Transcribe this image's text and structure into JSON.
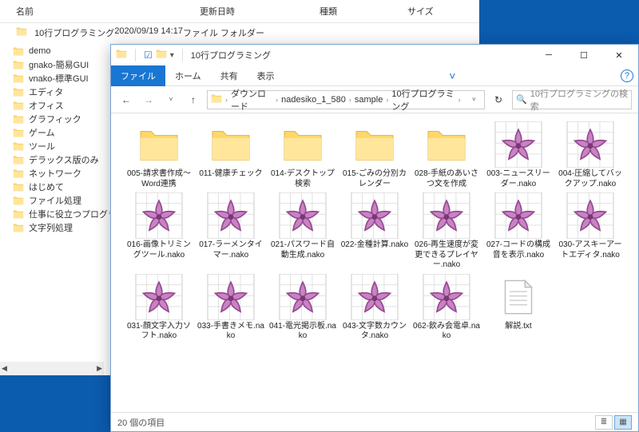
{
  "back": {
    "headers": {
      "name": "名前",
      "date": "更新日時",
      "type": "種類",
      "size": "サイズ"
    },
    "row": {
      "date": "2020/09/19 14:17",
      "type": "ファイル フォルダー"
    },
    "items": [
      "10行プログラミング",
      "demo",
      "gnako-簡易GUI",
      "vnako-標準GUI",
      "エディタ",
      "オフィス",
      "グラフィック",
      "ゲーム",
      "ツール",
      "デラックス版のみ",
      "ネットワーク",
      "はじめて",
      "ファイル処理",
      "仕事に役立つプログラミ",
      "文字列処理"
    ]
  },
  "front": {
    "title": "10行プログラミング",
    "tabs": {
      "file": "ファイル",
      "home": "ホーム",
      "share": "共有",
      "view": "表示"
    },
    "breadcrumb": [
      "ダウンロード",
      "nadesiko_1_580",
      "sample",
      "10行プログラミング"
    ],
    "search_placeholder": "10行プログラミングの検索",
    "grid": [
      {
        "name": "005-請求書作成～Word連携",
        "kind": "folder"
      },
      {
        "name": "011-健康チェック",
        "kind": "folder"
      },
      {
        "name": "014-デスクトップ検索",
        "kind": "folder"
      },
      {
        "name": "015-ごみの分別カレンダー",
        "kind": "folder"
      },
      {
        "name": "028-手紙のあいさつ文を作成",
        "kind": "folder"
      },
      {
        "name": "003-ニュースリーダー.nako",
        "kind": "nako"
      },
      {
        "name": "004-圧縮してバックアップ.nako",
        "kind": "nako"
      },
      {
        "name": "016-画像トリミングツール.nako",
        "kind": "nako"
      },
      {
        "name": "017-ラーメンタイマー.nako",
        "kind": "nako"
      },
      {
        "name": "021-パスワード自動生成.nako",
        "kind": "nako"
      },
      {
        "name": "022-金種計算.nako",
        "kind": "nako"
      },
      {
        "name": "026-再生速度が変更できるプレイヤー.nako",
        "kind": "nako"
      },
      {
        "name": "027-コードの構成音を表示.nako",
        "kind": "nako"
      },
      {
        "name": "030-アスキーアートエディタ.nako",
        "kind": "nako"
      },
      {
        "name": "031-顔文字入力ソフト.nako",
        "kind": "nako"
      },
      {
        "name": "033-手書きメモ.nako",
        "kind": "nako"
      },
      {
        "name": "041-電光掲示板.nako",
        "kind": "nako"
      },
      {
        "name": "043-文字数カウンタ.nako",
        "kind": "nako"
      },
      {
        "name": "062-飲み会電卓.nako",
        "kind": "nako"
      },
      {
        "name": "解説.txt",
        "kind": "txt"
      }
    ],
    "status": "20 個の項目"
  }
}
